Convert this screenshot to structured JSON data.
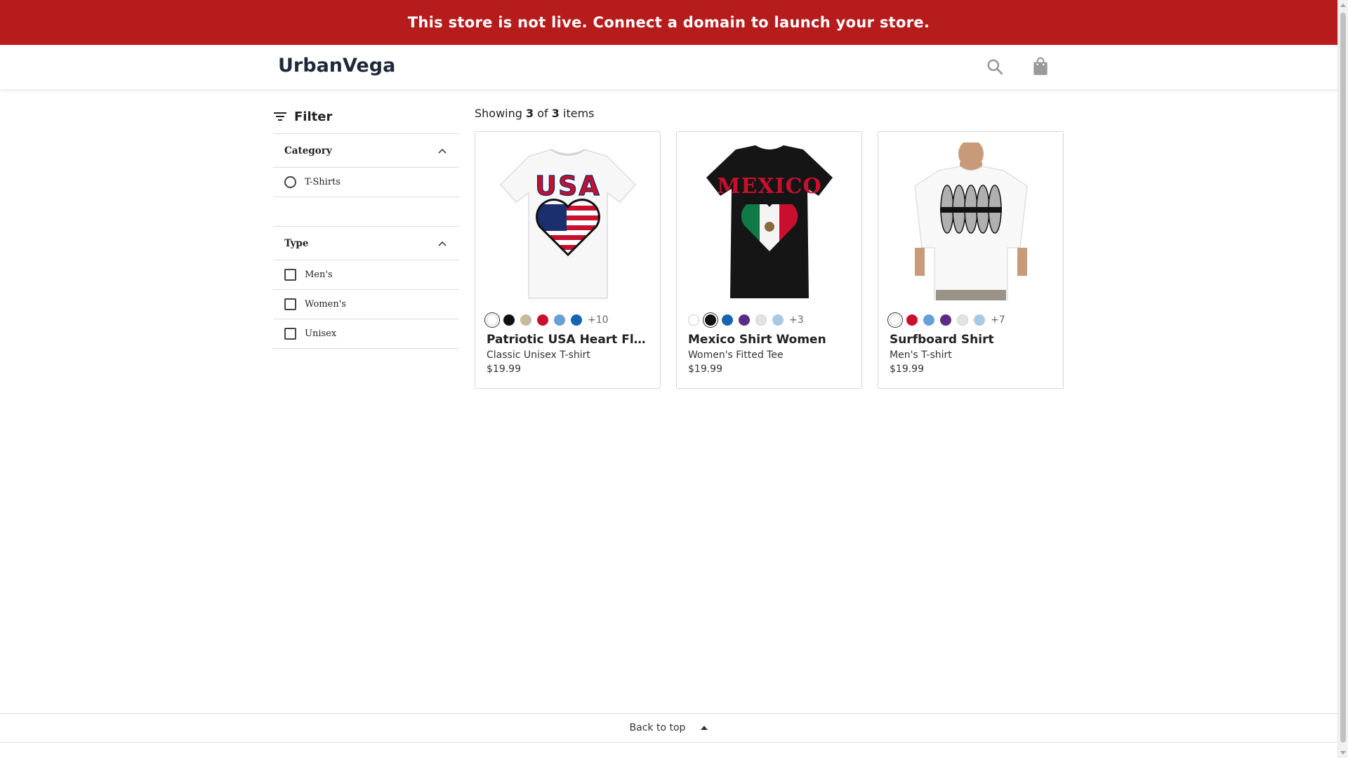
{
  "banner": {
    "text": "This store is not live. Connect a domain to launch your store."
  },
  "header": {
    "logo": "UrbanVega",
    "search_icon": "search-icon",
    "cart_icon": "shopping-bag-icon"
  },
  "sidebar": {
    "filter_label": "Filter",
    "sections": [
      {
        "title": "Category",
        "options": [
          "T-Shirts"
        ],
        "control": "radio"
      },
      {
        "title": "Type",
        "options": [
          "Men's",
          "Women's",
          "Unisex"
        ],
        "control": "checkbox"
      }
    ]
  },
  "results": {
    "prefix": "Showing",
    "shown": "3",
    "of": "of",
    "total": "3",
    "suffix": "items"
  },
  "products": [
    {
      "name": "Patriotic USA Heart Fla...",
      "type": "Classic Unisex T-shirt",
      "price": "$19.99",
      "more_colors": "+10",
      "swatches": [
        "#ffffff",
        "#111111",
        "#c8b89d",
        "#c8102e",
        "#6a9fd4",
        "#1565b0"
      ],
      "selected": 0
    },
    {
      "name": "Mexico Shirt Women",
      "type": "Women's Fitted Tee",
      "price": "$19.99",
      "more_colors": "+3",
      "swatches": [
        "#ffffff",
        "#111111",
        "#1565b0",
        "#5b2c83",
        "#e3e3e3",
        "#a8c8e4"
      ],
      "selected": 1
    },
    {
      "name": "Surfboard Shirt",
      "type": "Men's T-shirt",
      "price": "$19.99",
      "more_colors": "+7",
      "swatches": [
        "#ffffff",
        "#c8102e",
        "#6a9fd4",
        "#5b2c83",
        "#e3e3e3",
        "#a8c8e4"
      ],
      "selected": 0
    }
  ],
  "footer": {
    "back_to_top": "Back to top"
  }
}
